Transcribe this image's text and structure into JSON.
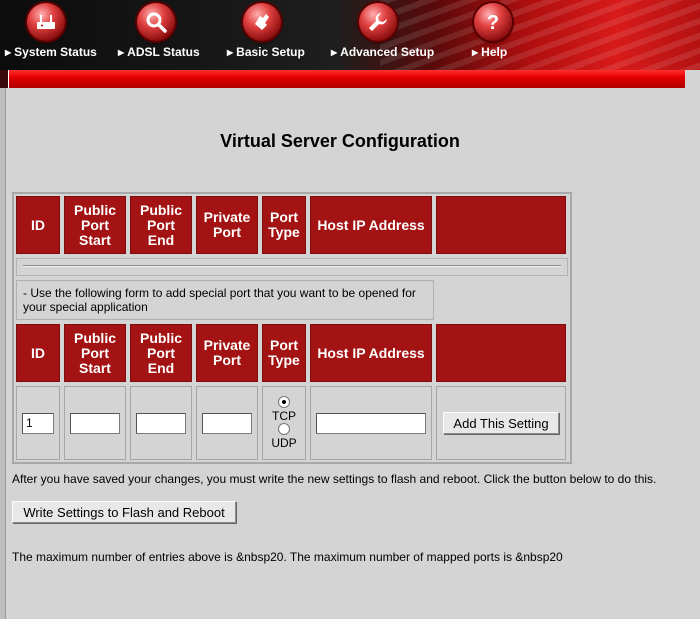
{
  "nav": {
    "items": [
      {
        "label": "System Status",
        "icon": "router-icon"
      },
      {
        "label": "ADSL Status",
        "icon": "magnifier-icon"
      },
      {
        "label": "Basic Setup",
        "icon": "hand-icon"
      },
      {
        "label": "Advanced Setup",
        "icon": "wrench-icon"
      },
      {
        "label": "Help",
        "icon": "question-icon"
      }
    ],
    "accent": "#d81a1a"
  },
  "page": {
    "title": "Virtual Server Configuration"
  },
  "table": {
    "headers": {
      "id": "ID",
      "public_port_start": "Public\nPort\nStart",
      "public_port_end": "Public\nPort\nEnd",
      "private_port": "Private\nPort",
      "port_type": "Port\nType",
      "host_ip": "Host IP Address"
    },
    "header_color": "#a31313",
    "instruction": "- Use the following form to add special port that you want to be opened for your special application",
    "form": {
      "id_value": "1",
      "public_port_start_value": "",
      "public_port_end_value": "",
      "private_port_value": "",
      "port_type_selected": "TCP",
      "tcp_label": "TCP",
      "udp_label": "UDP",
      "host_ip_value": "",
      "add_button": "Add This Setting"
    }
  },
  "footer": {
    "save_note": "After you have saved your changes, you must write the new settings to flash and reboot. Click the button below to do this.",
    "write_button": "Write Settings to Flash and Reboot",
    "max_note": "The maximum number of entries above is &nbsp20. The maximum number of mapped ports is &nbsp20"
  }
}
